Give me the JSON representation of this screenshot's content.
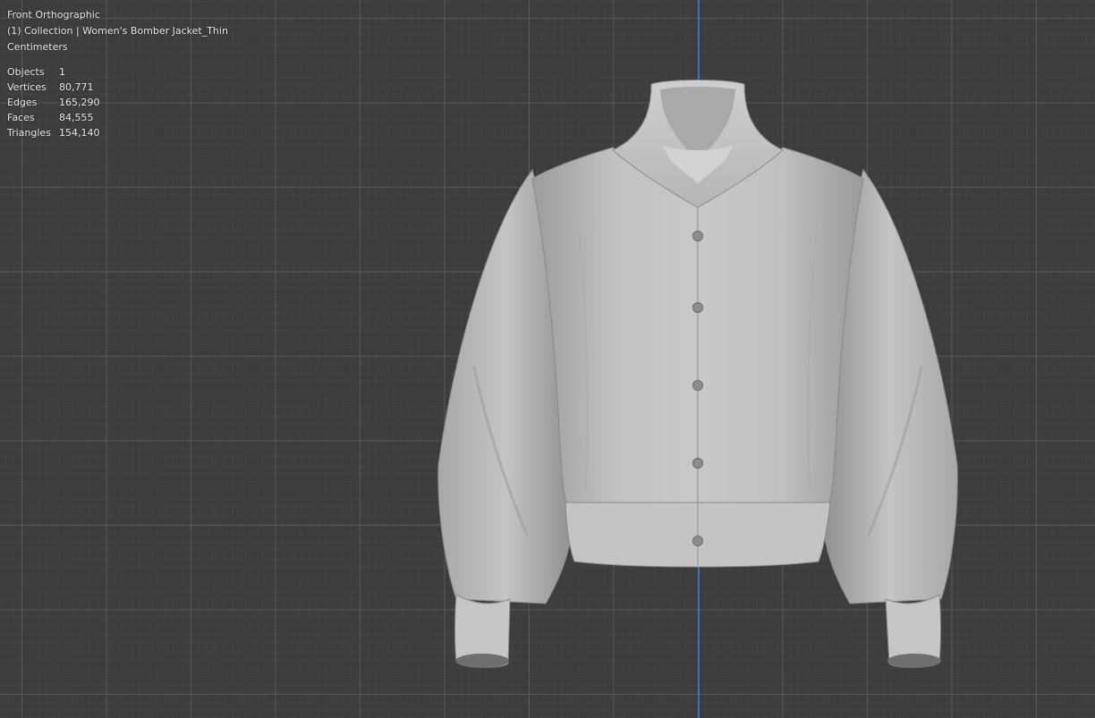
{
  "viewport": {
    "view_name": "Front Orthographic",
    "collection_line": "(1) Collection | Women's Bomber Jacket_Thin",
    "units": "Centimeters",
    "stats": [
      {
        "label": "Objects",
        "value": "1"
      },
      {
        "label": "Vertices",
        "value": "80,771"
      },
      {
        "label": "Edges",
        "value": "165,290"
      },
      {
        "label": "Faces",
        "value": "84,555"
      },
      {
        "label": "Triangles",
        "value": "154,140"
      }
    ]
  },
  "colors": {
    "background": "#3d3d3d",
    "grid_major": "#5a5a5a",
    "z_axis": "#3b6fbf",
    "garment": "#bdbdbd"
  }
}
